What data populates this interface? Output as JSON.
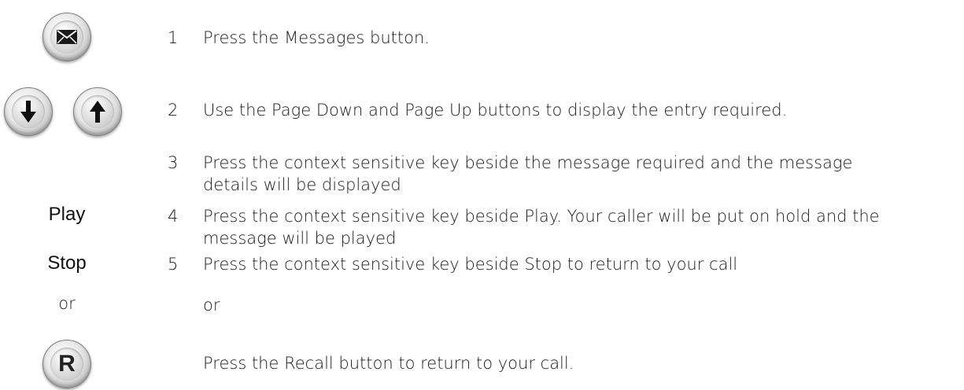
{
  "steps": [
    {
      "number": "1",
      "text": "Press the Messages button."
    },
    {
      "number": "2",
      "text": "Use the Page Down and Page Up buttons to display the entry required."
    },
    {
      "number": "3",
      "text_line1": "Press the context sensitive key beside the message required and the message",
      "text_line2": "details will be displayed"
    },
    {
      "number": "4",
      "text_line1": "Press the context sensitive key beside Play.  Your caller will be put on hold and the",
      "text_line2": "message will be played"
    },
    {
      "number": "5",
      "text": "Press the context sensitive key beside Stop to return to your call"
    }
  ],
  "softkeys": {
    "play": "Play",
    "stop": "Stop"
  },
  "alternative": {
    "or_label_left": "or",
    "or_label_right": "or",
    "text": "Press the Recall button to return to your call."
  },
  "buttons": {
    "recall_letter": "R"
  },
  "icons": {
    "messages": "envelope-icon",
    "page_down": "arrow-down-icon",
    "page_up": "arrow-up-icon",
    "recall": "recall-r-icon"
  }
}
